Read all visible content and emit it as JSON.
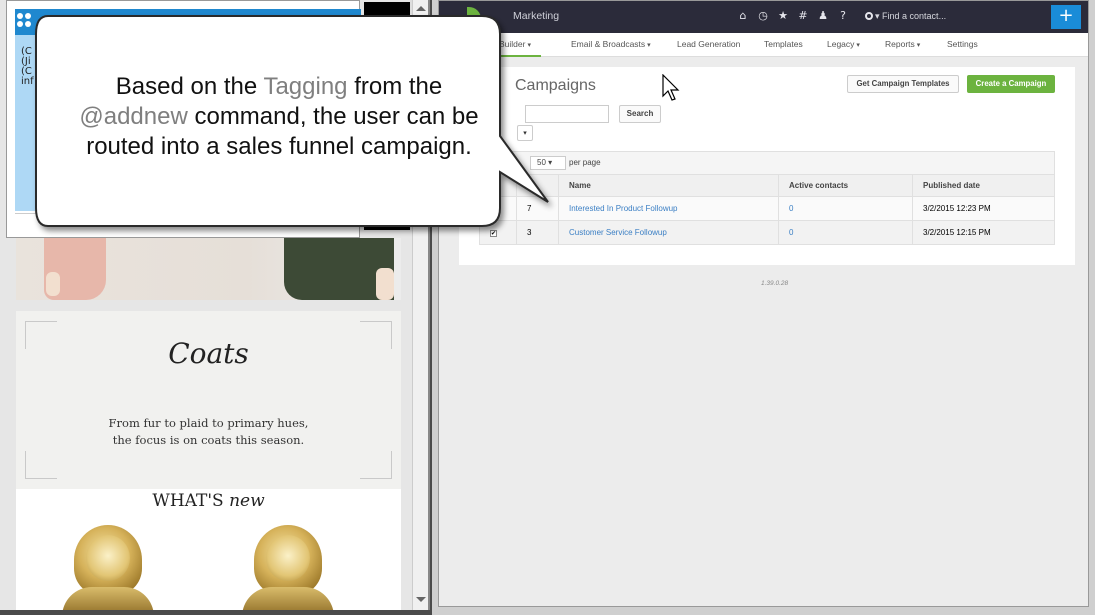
{
  "left_window": {
    "chat": {
      "lines": [
        "(C",
        "(Ji",
        "(C",
        "inf"
      ]
    },
    "store": {
      "coats_title": "Coats",
      "coats_desc_line1": "From fur to plaid to primary hues,",
      "coats_desc_line2": "the focus is on coats this season.",
      "whats_new_prefix": "WHAT'S",
      "whats_new_suffix": "new"
    }
  },
  "callout": {
    "line1_before": "Based on the ",
    "line1_highlight": "Tagging",
    "line1_after": " from the",
    "line2_highlight": "@addnew",
    "line2_after": " command, the user can be",
    "line3": "routed into a sales funnel campaign.",
    "highlight_color": "#7f7f7f"
  },
  "app": {
    "title": "Marketing",
    "top_icons": [
      "home-icon",
      "clock-icon",
      "star-icon",
      "hash-icon",
      "person-icon",
      "help-icon"
    ],
    "find_contact_label": "Find a contact...",
    "plus_label": "+",
    "nav": {
      "builder": "Builder",
      "email": "Email & Broadcasts",
      "lead": "Lead Generation",
      "templates": "Templates",
      "legacy": "Legacy",
      "reports": "Reports",
      "settings": "Settings"
    },
    "page_title": "Campaigns",
    "get_templates_label": "Get Campaign Templates",
    "create_label": "Create a Campaign",
    "search_value": "",
    "search_label": "Search",
    "per_page_value": "50",
    "per_page_label": "per page",
    "columns": [
      "",
      "Name",
      "Active contacts",
      "Published date"
    ],
    "rows": [
      {
        "id": "7",
        "name": "Interested In Product Followup",
        "active": "0",
        "published": "3/2/2015 12:23 PM",
        "checked": false
      },
      {
        "id": "3",
        "name": "Customer Service Followup",
        "active": "0",
        "published": "3/2/2015 12:15 PM",
        "checked": true
      }
    ],
    "version": "1.39.0.28",
    "accent_green": "#6cb33f",
    "accent_blue": "#1a8cd8"
  }
}
